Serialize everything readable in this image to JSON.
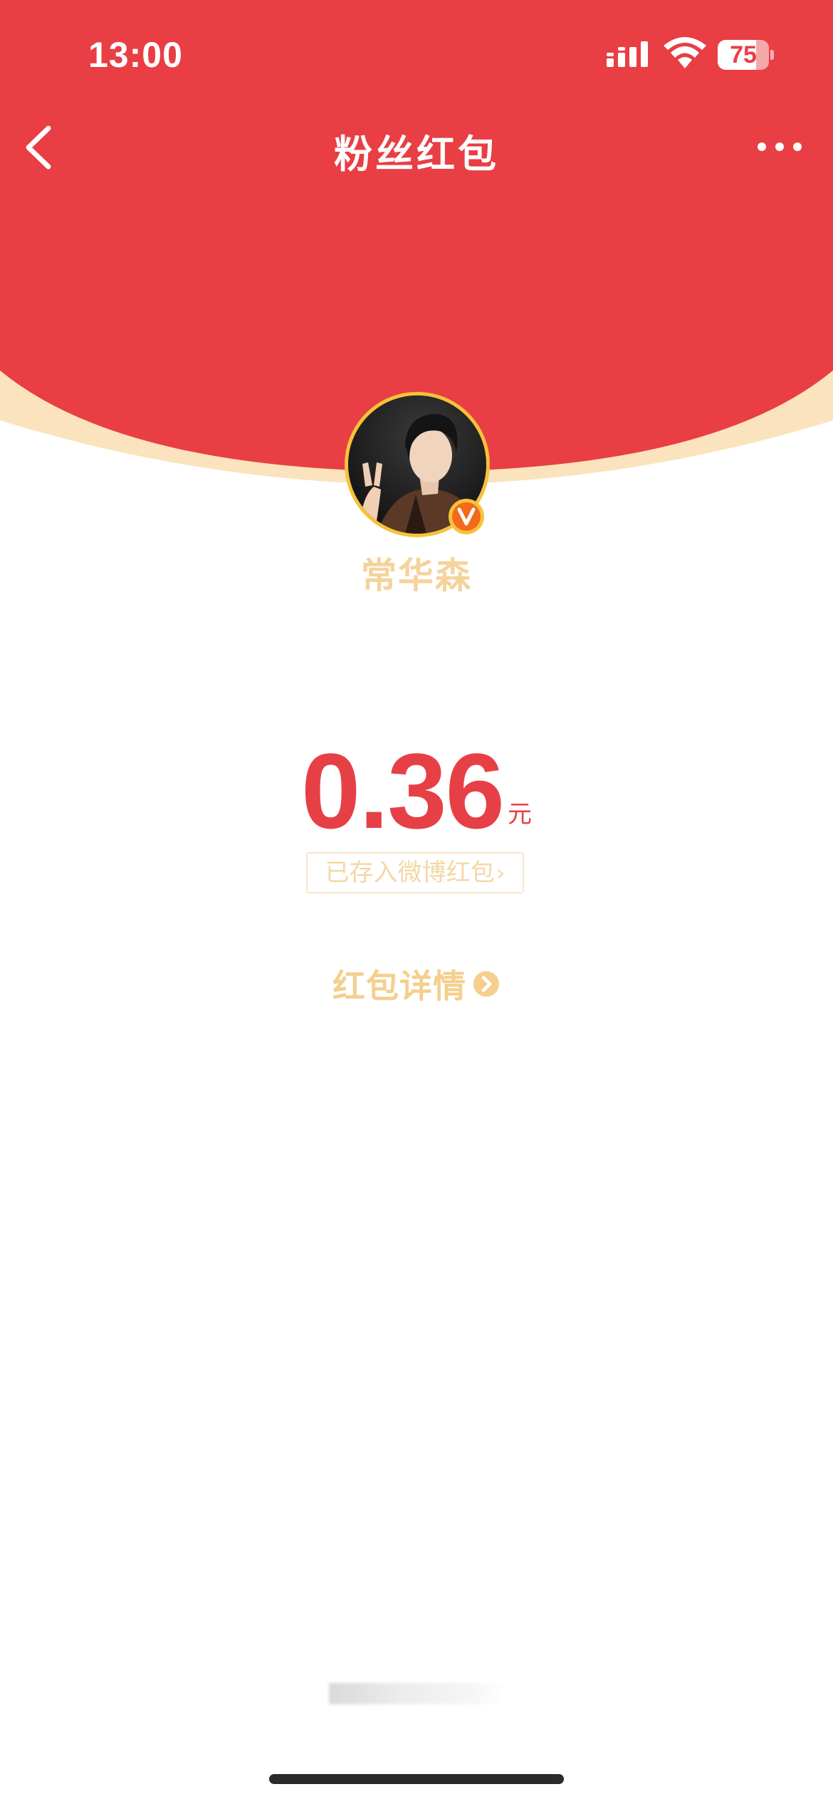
{
  "colors": {
    "header_red": "#e83e44",
    "rim_cream": "#fbe3bd",
    "amount_red": "#e64046",
    "gold": "#f4cf8e"
  },
  "status_bar": {
    "time": "13:00",
    "battery": "75",
    "battery_level_percent": 75,
    "icons": [
      "signal-icon",
      "wifi-icon",
      "battery-icon"
    ]
  },
  "nav": {
    "title": "粉丝红包",
    "back_icon": "back-chevron-icon",
    "more_icon": "more-dots-icon"
  },
  "sender": {
    "name": "常华森",
    "verified_badge": "V"
  },
  "amount": {
    "value": "0.36",
    "unit": "元"
  },
  "saved_link": {
    "label": "已存入微博红包",
    "chevron": "›"
  },
  "details_link": {
    "label": "红包详情",
    "icon": "chevron-right-circle-icon"
  }
}
